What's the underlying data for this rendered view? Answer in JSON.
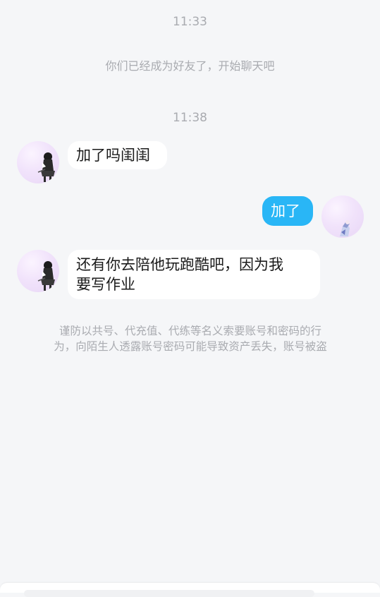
{
  "chat": {
    "time_1": "11:33",
    "system_note": "你们已经成为好友了，开始聊天吧",
    "time_2": "11:38",
    "messages": [
      {
        "sender": "other",
        "text": "加了吗闺闺"
      },
      {
        "sender": "self",
        "text": "加了"
      },
      {
        "sender": "other",
        "text_line1": "还有你去陪他玩跑酷吧，因为我",
        "text_line2": "要写作业"
      }
    ],
    "warning_line1": "谨防以共号、代充值、代练等名义索要账号和密码的行",
    "warning_line2": "为，向陌生人透露账号密码可能导致资产丢失，账号被盗"
  },
  "colors": {
    "background": "#f5f6f8",
    "self_bubble": "#29b6f6",
    "other_bubble": "#ffffff",
    "muted_text": "#a9abb0"
  }
}
